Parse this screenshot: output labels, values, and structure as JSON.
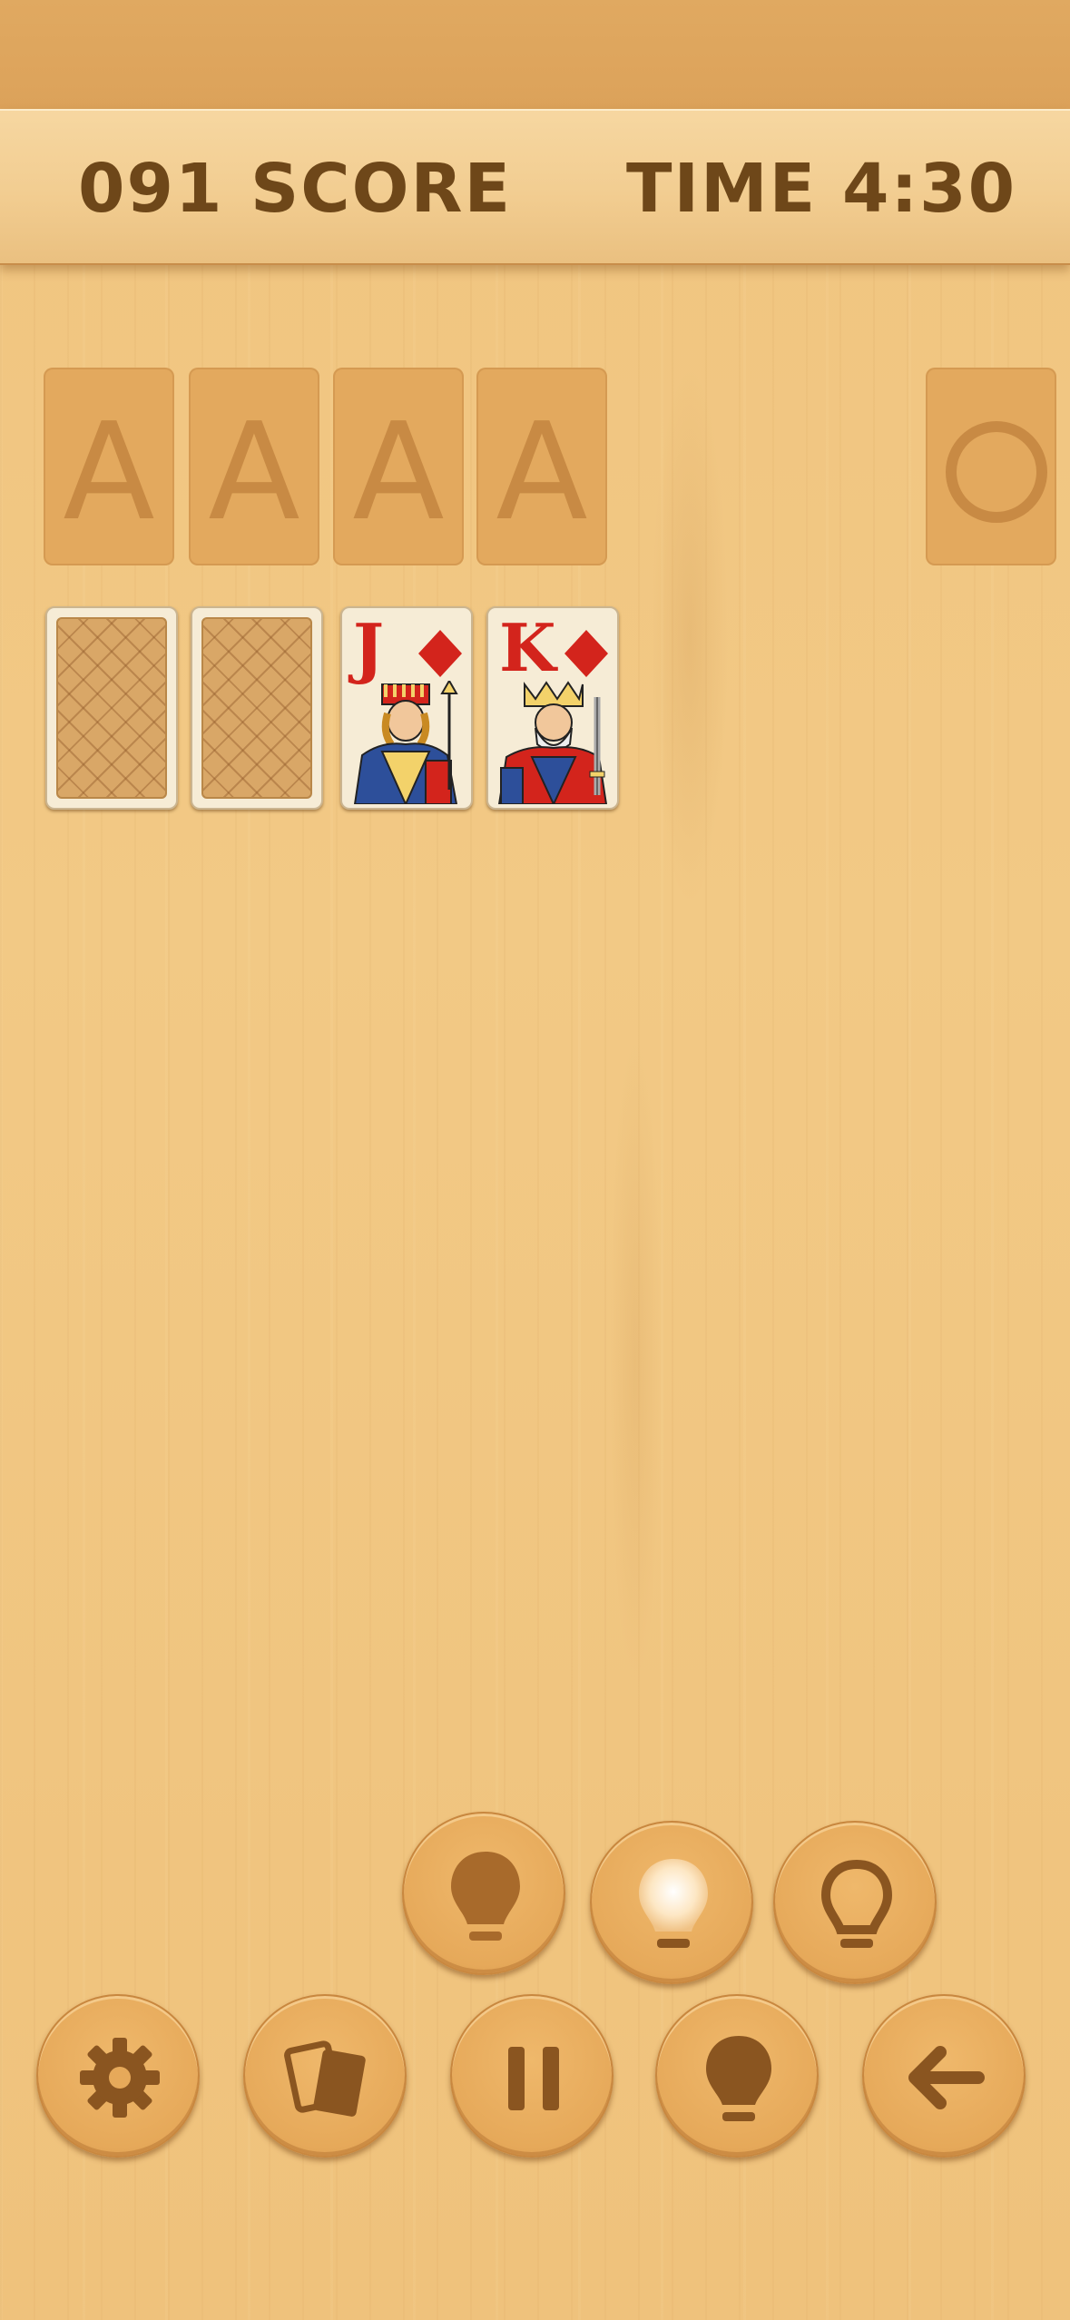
{
  "header": {
    "score_value": "091",
    "score_label": "SCORE",
    "time_label": "TIME",
    "time_value": "4:30"
  },
  "foundations": [
    {
      "label": "A"
    },
    {
      "label": "A"
    },
    {
      "label": "A"
    },
    {
      "label": "A"
    }
  ],
  "stock": {
    "icon": "circle-icon"
  },
  "tableau": [
    {
      "face": "down"
    },
    {
      "face": "down"
    },
    {
      "face": "up",
      "rank": "J",
      "suit": "diamond",
      "suit_color": "#d3241c"
    },
    {
      "face": "up",
      "rank": "K",
      "suit": "diamond",
      "suit_color": "#d3241c"
    }
  ],
  "hint_buttons": [
    {
      "icon": "bulb-filled-icon"
    },
    {
      "icon": "bulb-glowing-icon"
    },
    {
      "icon": "bulb-outline-icon"
    }
  ],
  "toolbar": [
    {
      "icon": "gear-icon"
    },
    {
      "icon": "cards-icon"
    },
    {
      "icon": "pause-icon"
    },
    {
      "icon": "bulb-icon"
    },
    {
      "icon": "arrow-left-icon"
    }
  ],
  "colors": {
    "accent_brown": "#6e4719",
    "button_face": "#e6a95a",
    "icon_brown": "#8a5520",
    "red_suit": "#d3241c"
  }
}
